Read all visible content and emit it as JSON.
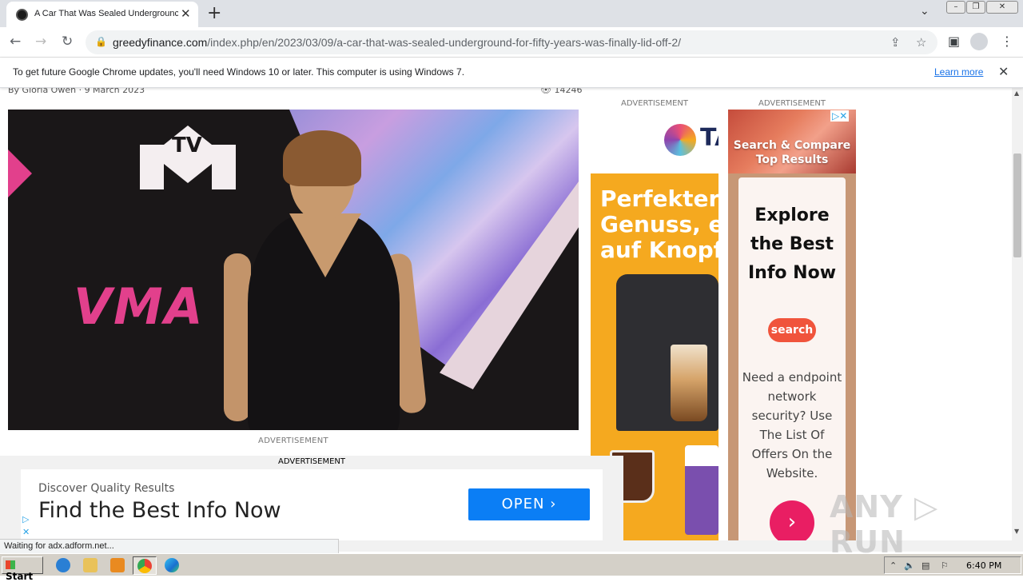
{
  "browser": {
    "tab_title": "A Car That Was Sealed Undergrounc",
    "tab_close": "✕",
    "new_tab": "+",
    "tab_search": "⌄",
    "url_domain": "greedyfinance.com",
    "url_path": "/index.php/en/2023/03/09/a-car-that-was-sealed-underground-for-fifty-years-was-finally-lid-off-2/"
  },
  "infobar": {
    "message": "To get future Google Chrome updates, you'll need Windows 10 or later. This computer is using Windows 7.",
    "learn_more": "Learn more",
    "close": "✕"
  },
  "article": {
    "byline": "By  Gloria Owen  ·  9 March 2023",
    "views": "👁 14246"
  },
  "ads": {
    "label": "ADVERTISEMENT",
    "coffee": {
      "brand": "TA",
      "headline_1": "Perfekter",
      "headline_2": "Genuss, ei",
      "headline_3": "auf Knopfo"
    },
    "search": {
      "banner": "Search & Compare Top Results",
      "heading_1": "Explore",
      "heading_2": "the Best",
      "heading_3": "Info Now",
      "pill": "search",
      "description": "Need a endpoint network security? Use The List Of Offers On the Website.",
      "go": "›"
    },
    "sticky": {
      "label": "ADVERTISEMENT",
      "small": "Discover Quality Results",
      "big": "Find the Best Info Now",
      "button": "OPEN  ›"
    }
  },
  "status_text": "Waiting for adx.adform.net...",
  "watermark": "ANY ▷ RUN",
  "taskbar": {
    "start": "Start",
    "clock": "6:40 PM"
  }
}
